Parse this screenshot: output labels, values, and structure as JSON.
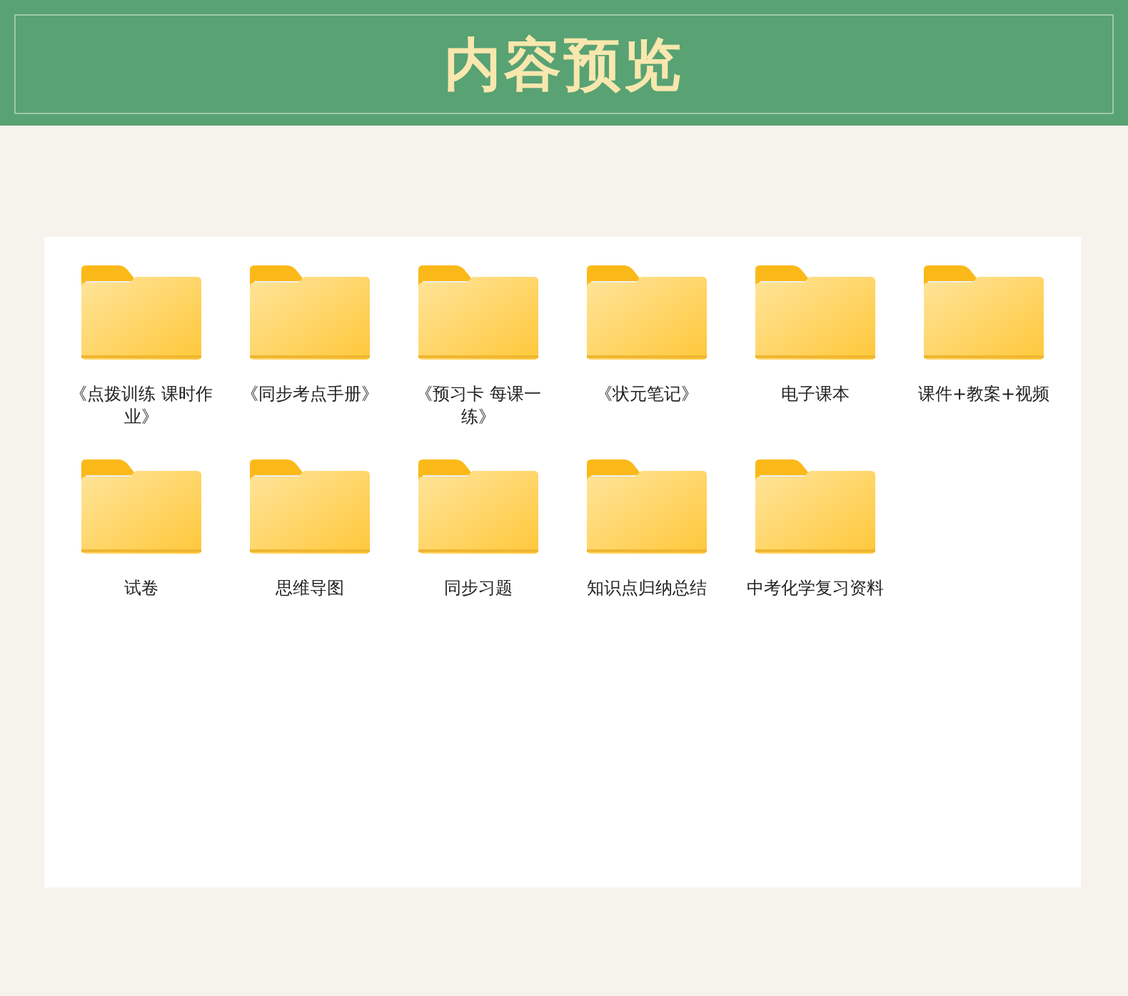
{
  "header": {
    "title": "内容预览"
  },
  "folders": [
    {
      "name": "《点拨训练 课时作业》"
    },
    {
      "name": "《同步考点手册》"
    },
    {
      "name": "《预习卡 每课一练》"
    },
    {
      "name": "《状元笔记》"
    },
    {
      "name": "电子课本"
    },
    {
      "name": "课件+教案+视频"
    },
    {
      "name": "试卷"
    },
    {
      "name": "思维导图"
    },
    {
      "name": "同步习题"
    },
    {
      "name": "知识点归纳总结"
    },
    {
      "name": "中考化学复习资料"
    }
  ]
}
